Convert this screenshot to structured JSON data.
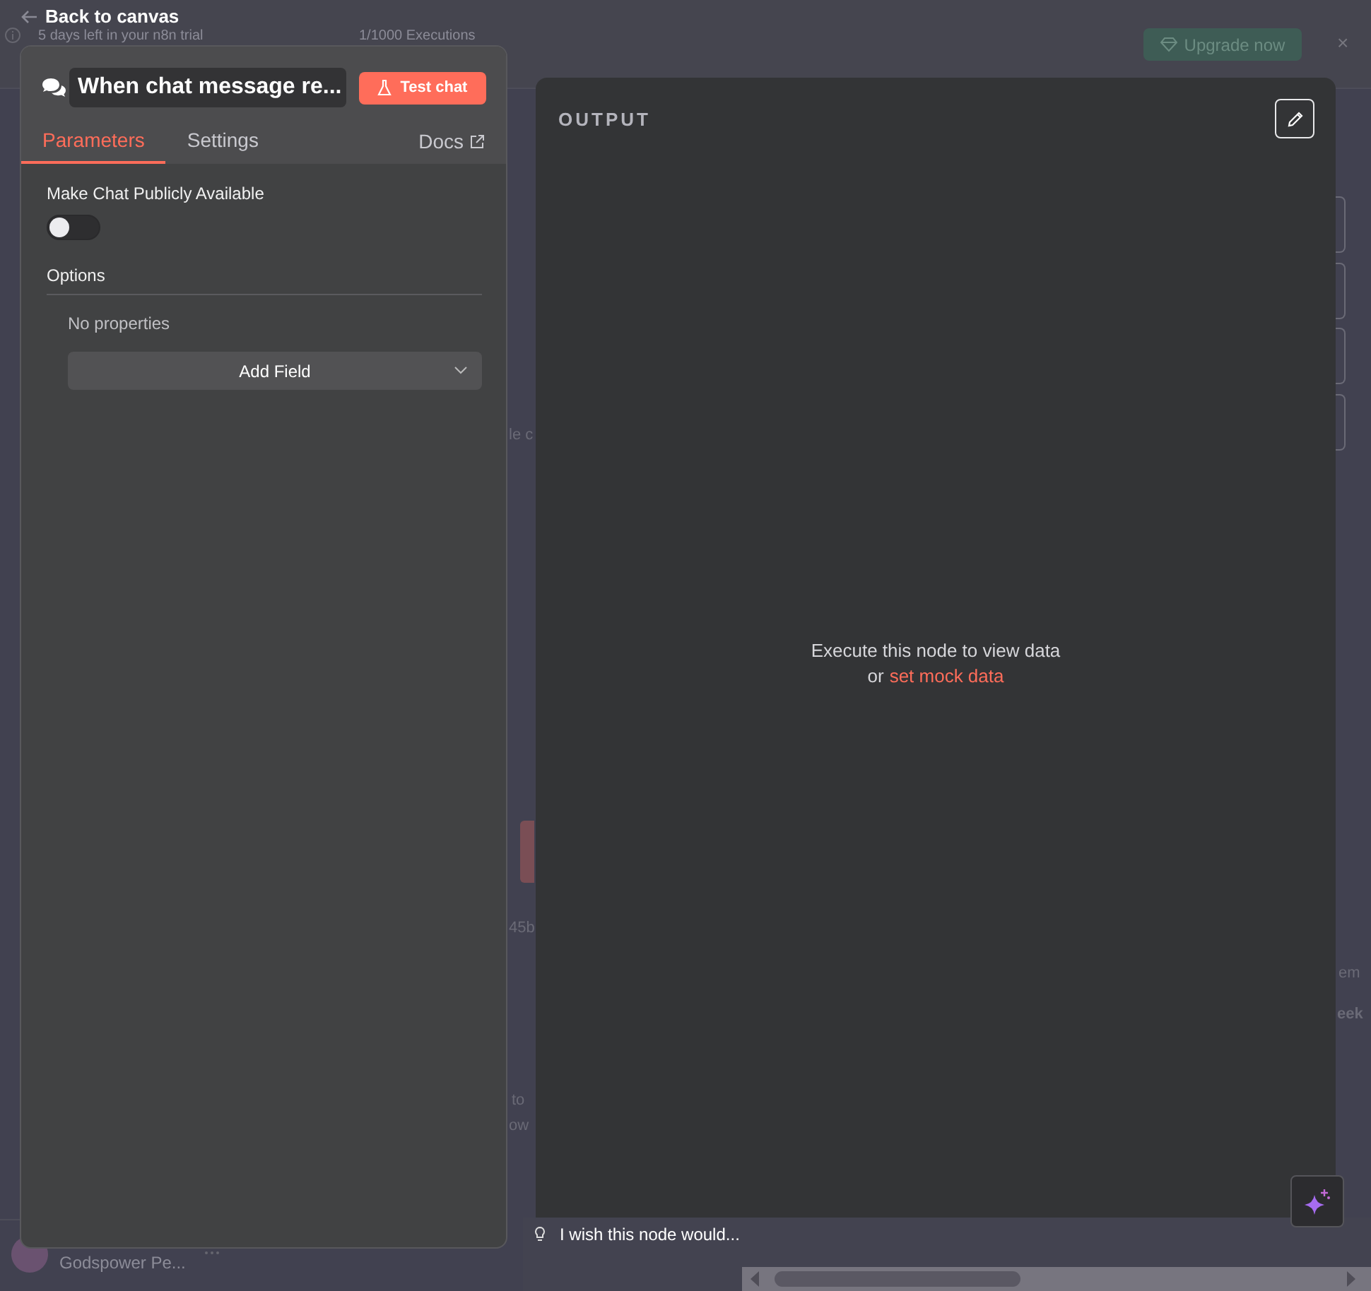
{
  "background": {
    "trial_notice": "5 days left in your n8n trial",
    "executions": "1/1000 Executions",
    "upgrade_button": "Upgrade now",
    "close": "×",
    "user_name": "Godspower Pe...",
    "canvas_fragments": [
      "le c",
      "45b",
      "to",
      "ow",
      "em",
      "eek"
    ]
  },
  "back_link": "Back to canvas",
  "node_panel": {
    "title": "When chat message re...",
    "test_button": "Test chat",
    "tabs": [
      {
        "label": "Parameters",
        "selected": true
      },
      {
        "label": "Settings",
        "selected": false
      }
    ],
    "docs_link": "Docs",
    "parameters": [
      {
        "kind": "toggle",
        "label": "Make Chat Publicly Available",
        "on": false
      }
    ],
    "options": {
      "heading": "Options",
      "empty_text": "No properties",
      "add_button": "Add Field"
    }
  },
  "output_panel": {
    "title": "OUTPUT",
    "empty_message": "Execute this node to view data",
    "mock_prefix": "or",
    "mock_link": "set mock data"
  },
  "feedback": {
    "prompt": "I wish this node would..."
  }
}
